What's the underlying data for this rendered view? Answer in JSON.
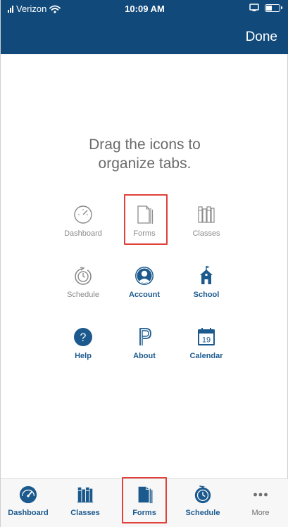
{
  "status_bar": {
    "carrier": "Verizon",
    "time": "10:09 AM",
    "battery_level": 0.45
  },
  "header": {
    "done_label": "Done"
  },
  "instruction": {
    "line1": "Drag the icons to",
    "line2": "organize tabs."
  },
  "grid": {
    "items": [
      {
        "label": "Dashboard",
        "icon": "dashboard-gauge-icon",
        "active": false
      },
      {
        "label": "Forms",
        "icon": "forms-document-icon",
        "active": false
      },
      {
        "label": "Classes",
        "icon": "classes-books-icon",
        "active": false
      },
      {
        "label": "Schedule",
        "icon": "schedule-clock-icon",
        "active": false
      },
      {
        "label": "Account",
        "icon": "account-person-icon",
        "active": true
      },
      {
        "label": "School",
        "icon": "school-building-icon",
        "active": true
      },
      {
        "label": "Help",
        "icon": "help-question-icon",
        "active": true
      },
      {
        "label": "About",
        "icon": "about-logo-icon",
        "active": true
      },
      {
        "label": "Calendar",
        "icon": "calendar-icon",
        "active": true
      }
    ],
    "calendar_day": "19"
  },
  "tab_bar": {
    "tabs": [
      {
        "label": "Dashboard",
        "icon": "dashboard-gauge-icon"
      },
      {
        "label": "Classes",
        "icon": "classes-books-icon"
      },
      {
        "label": "Forms",
        "icon": "forms-document-icon"
      },
      {
        "label": "Schedule",
        "icon": "schedule-clock-icon"
      },
      {
        "label": "More",
        "icon": "more-dots-icon"
      }
    ]
  },
  "colors": {
    "header_bg": "#114a7a",
    "active_blue": "#1c5a8e",
    "inactive_gray": "#8a8a8a",
    "highlight_red": "#e0413a"
  }
}
